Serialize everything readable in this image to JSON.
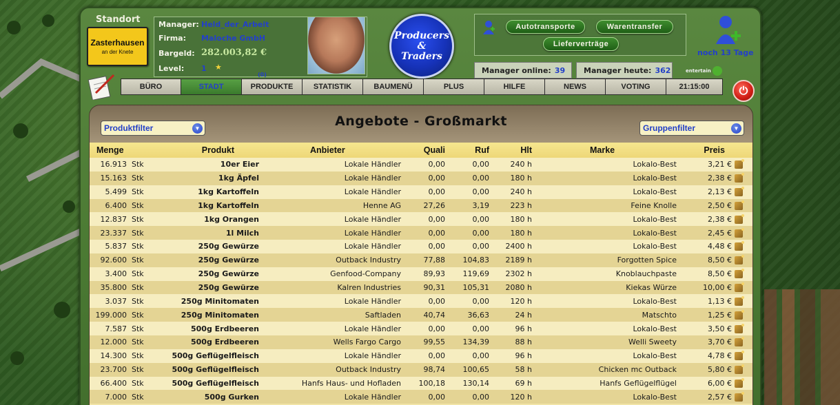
{
  "header": {
    "standort_label": "Standort",
    "town": {
      "name": "Zasterhausen",
      "sub": "an der Knete"
    },
    "manager": {
      "label": "Manager:",
      "value": "Held_der_Arbeit"
    },
    "firma": {
      "label": "Firma:",
      "value": "Maloche GmbH"
    },
    "bargeld": {
      "label": "Bargeld:",
      "value": "282.003,82 €"
    },
    "level": {
      "label": "Level:",
      "value": "1",
      "small": "(0)"
    },
    "logo_lines": [
      "Producers",
      "&",
      "Traders"
    ],
    "buttons": {
      "autotransporte": "Autotransporte",
      "warentransfer": "Warentransfer",
      "liefervertraege": "Lieferverträge"
    },
    "manager_online": {
      "label": "Manager online:",
      "value": "39"
    },
    "manager_heute": {
      "label": "Manager heute:",
      "value": "362"
    },
    "noch_tage": "noch 13 Tage",
    "entertain": "entertain"
  },
  "nav": {
    "tabs": [
      "BÜRO",
      "STADT",
      "PRODUKTE",
      "STATISTIK",
      "BAUMENÜ",
      "PLUS",
      "HILFE",
      "NEWS",
      "VOTING"
    ],
    "active": "STADT",
    "time": "21:15:00"
  },
  "panel": {
    "title": "Angebote - Großmarkt",
    "produktfilter": "Produktfilter",
    "gruppenfilter": "Gruppenfilter"
  },
  "table": {
    "headers": {
      "menge": "Menge",
      "produkt": "Produkt",
      "anbieter": "Anbieter",
      "quali": "Quali",
      "ruf": "Ruf",
      "hlt": "Hlt",
      "marke": "Marke",
      "preis": "Preis"
    },
    "rows": [
      {
        "menge": "16.913",
        "unit": "Stk",
        "produkt": "10er Eier",
        "anbieter": "Lokale Händler",
        "quali": "0,00",
        "ruf": "0,00",
        "hlt": "240 h",
        "marke": "Lokalo-Best",
        "preis": "3,21 €"
      },
      {
        "menge": "15.163",
        "unit": "Stk",
        "produkt": "1kg Äpfel",
        "anbieter": "Lokale Händler",
        "quali": "0,00",
        "ruf": "0,00",
        "hlt": "180 h",
        "marke": "Lokalo-Best",
        "preis": "2,38 €"
      },
      {
        "menge": "5.499",
        "unit": "Stk",
        "produkt": "1kg Kartoffeln",
        "anbieter": "Lokale Händler",
        "quali": "0,00",
        "ruf": "0,00",
        "hlt": "240 h",
        "marke": "Lokalo-Best",
        "preis": "2,13 €"
      },
      {
        "menge": "6.400",
        "unit": "Stk",
        "produkt": "1kg Kartoffeln",
        "anbieter": "Henne AG",
        "quali": "27,26",
        "ruf": "3,19",
        "hlt": "223 h",
        "marke": "Feine Knolle",
        "preis": "2,50 €"
      },
      {
        "menge": "12.837",
        "unit": "Stk",
        "produkt": "1kg Orangen",
        "anbieter": "Lokale Händler",
        "quali": "0,00",
        "ruf": "0,00",
        "hlt": "180 h",
        "marke": "Lokalo-Best",
        "preis": "2,38 €"
      },
      {
        "menge": "23.337",
        "unit": "Stk",
        "produkt": "1l Milch",
        "anbieter": "Lokale Händler",
        "quali": "0,00",
        "ruf": "0,00",
        "hlt": "180 h",
        "marke": "Lokalo-Best",
        "preis": "2,45 €"
      },
      {
        "menge": "5.837",
        "unit": "Stk",
        "produkt": "250g Gewürze",
        "anbieter": "Lokale Händler",
        "quali": "0,00",
        "ruf": "0,00",
        "hlt": "2400 h",
        "marke": "Lokalo-Best",
        "preis": "4,48 €"
      },
      {
        "menge": "92.600",
        "unit": "Stk",
        "produkt": "250g Gewürze",
        "anbieter": "Outback Industry",
        "quali": "77,88",
        "ruf": "104,83",
        "hlt": "2189 h",
        "marke": "Forgotten Spice",
        "preis": "8,50 €"
      },
      {
        "menge": "3.400",
        "unit": "Stk",
        "produkt": "250g Gewürze",
        "anbieter": "Genfood-Company",
        "quali": "89,93",
        "ruf": "119,69",
        "hlt": "2302 h",
        "marke": "Knoblauchpaste",
        "preis": "8,50 €"
      },
      {
        "menge": "35.800",
        "unit": "Stk",
        "produkt": "250g Gewürze",
        "anbieter": "Kalren Industries",
        "quali": "90,31",
        "ruf": "105,31",
        "hlt": "2080 h",
        "marke": "Kiekas Würze",
        "preis": "10,00 €"
      },
      {
        "menge": "3.037",
        "unit": "Stk",
        "produkt": "250g Minitomaten",
        "anbieter": "Lokale Händler",
        "quali": "0,00",
        "ruf": "0,00",
        "hlt": "120 h",
        "marke": "Lokalo-Best",
        "preis": "1,13 €"
      },
      {
        "menge": "199.000",
        "unit": "Stk",
        "produkt": "250g Minitomaten",
        "anbieter": "Saftladen",
        "quali": "40,74",
        "ruf": "36,63",
        "hlt": "24 h",
        "marke": "Matschto",
        "preis": "1,25 €"
      },
      {
        "menge": "7.587",
        "unit": "Stk",
        "produkt": "500g Erdbeeren",
        "anbieter": "Lokale Händler",
        "quali": "0,00",
        "ruf": "0,00",
        "hlt": "96 h",
        "marke": "Lokalo-Best",
        "preis": "3,50 €"
      },
      {
        "menge": "12.000",
        "unit": "Stk",
        "produkt": "500g Erdbeeren",
        "anbieter": "Wells Fargo Cargo",
        "quali": "99,55",
        "ruf": "134,39",
        "hlt": "88 h",
        "marke": "Welli Sweety",
        "preis": "3,70 €"
      },
      {
        "menge": "14.300",
        "unit": "Stk",
        "produkt": "500g Geflügelfleisch",
        "anbieter": "Lokale Händler",
        "quali": "0,00",
        "ruf": "0,00",
        "hlt": "96 h",
        "marke": "Lokalo-Best",
        "preis": "4,78 €"
      },
      {
        "menge": "23.700",
        "unit": "Stk",
        "produkt": "500g Geflügelfleisch",
        "anbieter": "Outback Industry",
        "quali": "98,74",
        "ruf": "100,65",
        "hlt": "58 h",
        "marke": "Chicken mc Outback",
        "preis": "5,80 €"
      },
      {
        "menge": "66.400",
        "unit": "Stk",
        "produkt": "500g Geflügelfleisch",
        "anbieter": "Hanfs Haus- und Hofladen",
        "quali": "100,18",
        "ruf": "130,14",
        "hlt": "69 h",
        "marke": "Hanfs Geflügelflügel",
        "preis": "6,00 €"
      },
      {
        "menge": "7.000",
        "unit": "Stk",
        "produkt": "500g Gurken",
        "anbieter": "Lokale Händler",
        "quali": "0,00",
        "ruf": "0,00",
        "hlt": "120 h",
        "marke": "Lokalo-Best",
        "preis": "2,57 €"
      }
    ]
  },
  "colors": {
    "link_blue": "#2340c8",
    "town_sign": "#f3c71b",
    "active_tab": "#4a8f38"
  }
}
